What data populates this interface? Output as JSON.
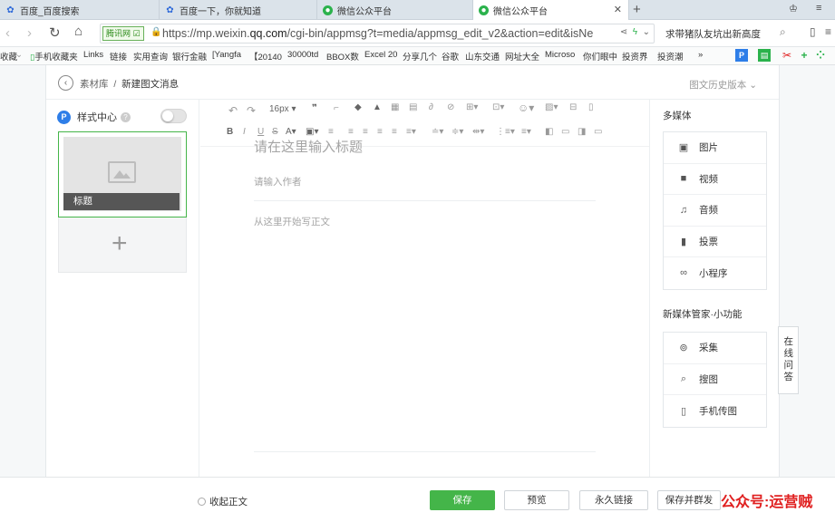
{
  "browser": {
    "tabs": [
      {
        "label": "百度_百度搜索",
        "icon": "baidu-paw-icon"
      },
      {
        "label": "百度一下，你就知道",
        "icon": "baidu-paw-icon"
      },
      {
        "label": "微信公众平台",
        "icon": "wechat-icon"
      },
      {
        "label": "微信公众平台",
        "icon": "wechat-icon"
      }
    ],
    "security_badge": "腾讯网",
    "url_prefix": "https://mp.weixin.",
    "url_domain": "qq.com",
    "url_rest": "/cgi-bin/appmsg?t=media/appmsg_edit_v2&action=edit&isNe",
    "news_text": "求带猪队友坑出新高度",
    "bookmarks": [
      "收藏",
      "手机收藏夹",
      "Links",
      "链接",
      "实用查询",
      "银行金融",
      "[Yangfa",
      "【20140",
      "30000td",
      "BBOX数",
      "Excel 20",
      "分享几个",
      "谷歌",
      "山东交通",
      "网址大全",
      "Microso",
      "你们眼中",
      "投资界",
      "投资潮",
      "»"
    ]
  },
  "breadcrumb": {
    "root": "素材库",
    "separator": "/",
    "current": "新建图文消息"
  },
  "history_version": "图文历史版本",
  "left": {
    "style_center_badge": "P",
    "style_center_label": "样式中心",
    "help": "?",
    "article_title": "标题",
    "add_symbol": "+"
  },
  "editor": {
    "font_size": "16px",
    "title_placeholder": "请在这里输入标题",
    "author_placeholder": "请输入作者",
    "body_placeholder": "从这里开始写正文"
  },
  "multimedia": {
    "title": "多媒体",
    "items": [
      {
        "label": "图片",
        "icon": "image-icon"
      },
      {
        "label": "视频",
        "icon": "video-icon"
      },
      {
        "label": "音频",
        "icon": "microphone-icon"
      },
      {
        "label": "投票",
        "icon": "bar-chart-icon"
      },
      {
        "label": "小程序",
        "icon": "mini-program-icon"
      }
    ]
  },
  "tools": {
    "title": "新媒体管家·小功能",
    "items": [
      {
        "label": "采集",
        "icon": "collect-icon"
      },
      {
        "label": "搜图",
        "icon": "search-icon"
      },
      {
        "label": "手机传图",
        "icon": "phone-upload-icon"
      }
    ]
  },
  "online_qa": "在线问答",
  "footer": {
    "collapse": "收起正文",
    "save": "保存",
    "preview": "预览",
    "permalink": "永久链接",
    "save_send": "保存并群发"
  },
  "watermark": "公众号:运营贼",
  "colors": {
    "accent_green": "#44b549",
    "watermark_red": "#e02020",
    "badge_blue": "#2e7ee8"
  }
}
